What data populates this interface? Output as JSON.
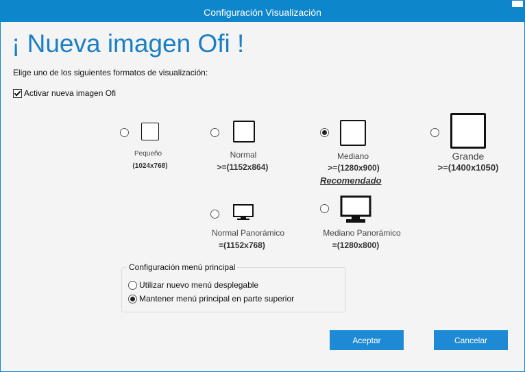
{
  "window": {
    "title": "Configuración Visualización"
  },
  "header": {
    "heading": "¡ Nueva imagen Ofi !"
  },
  "instructions": "Elige uno de los siguientes formatos de visualización:",
  "activate_checkbox": {
    "label": "Activar nueva imagen Ofi",
    "checked": true
  },
  "formats": [
    {
      "name": "Pequeño",
      "resolution": "(1024x768)",
      "selected": false
    },
    {
      "name": "Normal",
      "resolution": ">=(1152x864)",
      "selected": false
    },
    {
      "name": "Mediano",
      "resolution": ">=(1280x900)",
      "selected": true,
      "note": "Recomendado"
    },
    {
      "name": "Grande",
      "resolution": ">=(1400x1050)",
      "selected": false
    },
    {
      "name": "Normal Panorámico",
      "resolution": "=(1152x768)",
      "selected": false
    },
    {
      "name": "Mediano Panorámico",
      "resolution": "=(1280x800)",
      "selected": false
    }
  ],
  "menu_group": {
    "legend": "Configuración menú principal",
    "options": [
      {
        "label": "Utilizar nuevo menú desplegable",
        "selected": false
      },
      {
        "label": "Mantener menú principal en parte superior",
        "selected": true
      }
    ]
  },
  "buttons": {
    "accept": "Aceptar",
    "cancel": "Cancelar"
  },
  "colors": {
    "accent": "#0e86cc",
    "heading": "#1b7fc6",
    "button": "#1e8ad6"
  }
}
